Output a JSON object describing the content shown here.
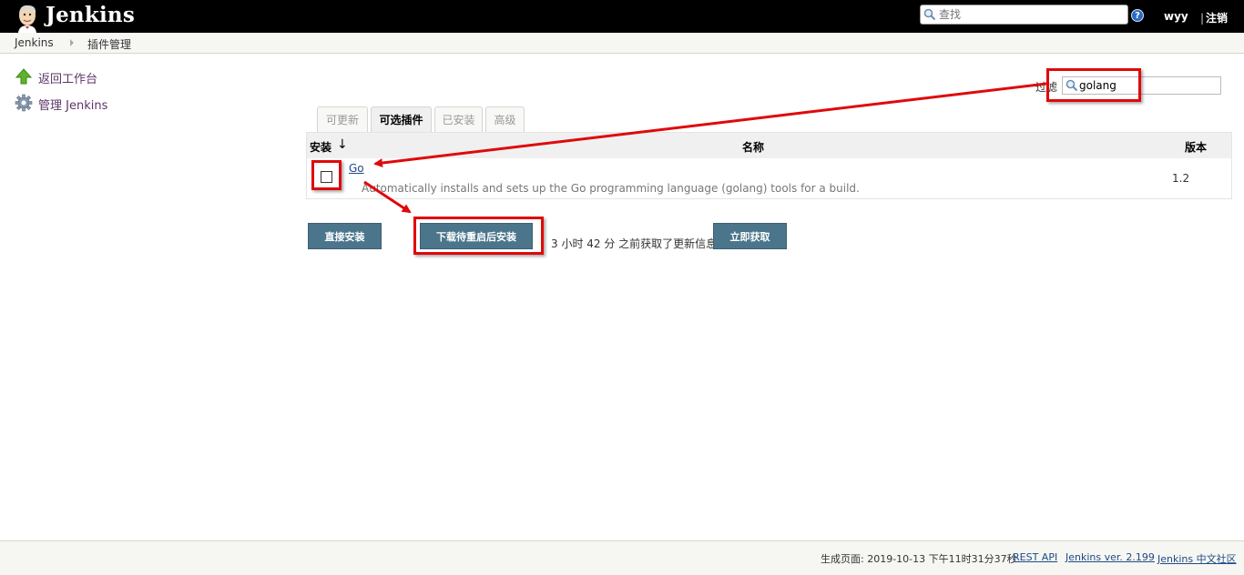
{
  "header": {
    "brand": "Jenkins",
    "search_placeholder": "查找",
    "help": "?",
    "user": "wyy",
    "logout": "注销"
  },
  "breadcrumb": [
    "Jenkins",
    "插件管理"
  ],
  "sidebar": {
    "items": [
      {
        "label": "返回工作台",
        "icon": "up-arrow-icon"
      },
      {
        "label": "管理 Jenkins",
        "icon": "gear-icon"
      }
    ]
  },
  "filter": {
    "label": "过滤",
    "value": "golang"
  },
  "tabs": [
    {
      "label": "可更新",
      "active": false
    },
    {
      "label": "可选插件",
      "active": true
    },
    {
      "label": "已安装",
      "active": false
    },
    {
      "label": "高级",
      "active": false
    }
  ],
  "table": {
    "headers": {
      "install": "安装",
      "sort": "↓",
      "name": "名称",
      "version": "版本"
    },
    "rows": [
      {
        "name": "Go",
        "description": "Automatically installs and sets up the Go programming language (golang) tools for a build.",
        "version": "1.2",
        "checked": false
      }
    ]
  },
  "buttons": {
    "install_now": "直接安装",
    "install_after_restart": "下载待重启后安装",
    "check_now": "立即获取"
  },
  "status_text": "3 小时 42 分 之前获取了更新信息",
  "footer": {
    "generated": "生成页面: 2019-10-13 下午11时31分37秒",
    "rest_api": "REST API",
    "version": "Jenkins ver. 2.199",
    "community": "Jenkins 中文社区"
  },
  "colors": {
    "header_bg": "#000000",
    "button_bg": "#4b758b",
    "annotation_red": "#e0090b",
    "link": "#204a87"
  }
}
